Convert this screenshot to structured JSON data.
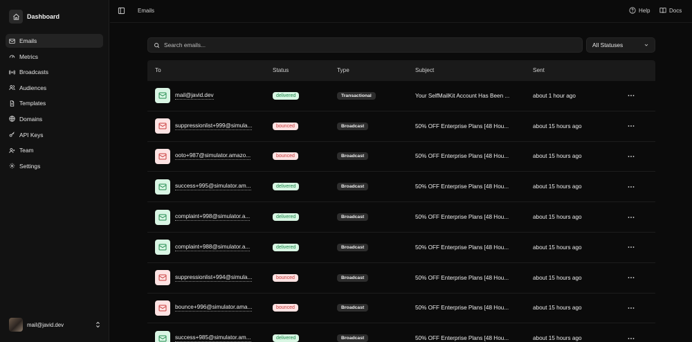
{
  "brand": {
    "title": "Dashboard",
    "icon": "home-icon"
  },
  "nav": [
    {
      "label": "Emails",
      "icon": "mail-icon",
      "active": true
    },
    {
      "label": "Metrics",
      "icon": "gauge-icon",
      "active": false
    },
    {
      "label": "Broadcasts",
      "icon": "radio-icon",
      "active": false
    },
    {
      "label": "Audiences",
      "icon": "users-icon",
      "active": false
    },
    {
      "label": "Templates",
      "icon": "file-icon",
      "active": false
    },
    {
      "label": "Domains",
      "icon": "globe-icon",
      "active": false
    },
    {
      "label": "API Keys",
      "icon": "key-icon",
      "active": false
    },
    {
      "label": "Team",
      "icon": "user-plus-icon",
      "active": false
    },
    {
      "label": "Settings",
      "icon": "gear-icon",
      "active": false
    }
  ],
  "user": {
    "email": "mail@javid.dev"
  },
  "topbar": {
    "breadcrumb": "Emails",
    "help": "Help",
    "docs": "Docs"
  },
  "search": {
    "placeholder": "Search emails..."
  },
  "filter": {
    "selected": "All Statuses"
  },
  "table": {
    "headers": {
      "to": "To",
      "status": "Status",
      "type": "Type",
      "subject": "Subject",
      "sent": "Sent"
    },
    "rows": [
      {
        "to": "mail@javid.dev",
        "status": "delivered",
        "type": "Transactional",
        "subject": "Your SelfMailKit Account Has Been ...",
        "sent": "about 1 hour ago"
      },
      {
        "to": "suppressionlist+999@simula...",
        "status": "bounced",
        "type": "Broadcast",
        "subject": "50% OFF Enterprise Plans [48 Hou...",
        "sent": "about 15 hours ago"
      },
      {
        "to": "ooto+987@simulator.amazo...",
        "status": "bounced",
        "type": "Broadcast",
        "subject": "50% OFF Enterprise Plans [48 Hou...",
        "sent": "about 15 hours ago"
      },
      {
        "to": "success+995@simulator.am...",
        "status": "delivered",
        "type": "Broadcast",
        "subject": "50% OFF Enterprise Plans [48 Hou...",
        "sent": "about 15 hours ago"
      },
      {
        "to": "complaint+998@simulator.a...",
        "status": "delivered",
        "type": "Broadcast",
        "subject": "50% OFF Enterprise Plans [48 Hou...",
        "sent": "about 15 hours ago"
      },
      {
        "to": "complaint+988@simulator.a...",
        "status": "delivered",
        "type": "Broadcast",
        "subject": "50% OFF Enterprise Plans [48 Hou...",
        "sent": "about 15 hours ago"
      },
      {
        "to": "suppressionlist+994@simula...",
        "status": "bounced",
        "type": "Broadcast",
        "subject": "50% OFF Enterprise Plans [48 Hou...",
        "sent": "about 15 hours ago"
      },
      {
        "to": "bounce+996@simulator.ama...",
        "status": "bounced",
        "type": "Broadcast",
        "subject": "50% OFF Enterprise Plans [48 Hou...",
        "sent": "about 15 hours ago"
      },
      {
        "to": "success+985@simulator.am...",
        "status": "delivered",
        "type": "Broadcast",
        "subject": "50% OFF Enterprise Plans [48 Hou...",
        "sent": "about 15 hours ago"
      }
    ]
  },
  "colors": {
    "delivered_text": "#1f8a4c",
    "delivered_bg": "#d8f6e3",
    "bounced_text": "#c83a3a",
    "bounced_bg": "#fde2e2"
  }
}
